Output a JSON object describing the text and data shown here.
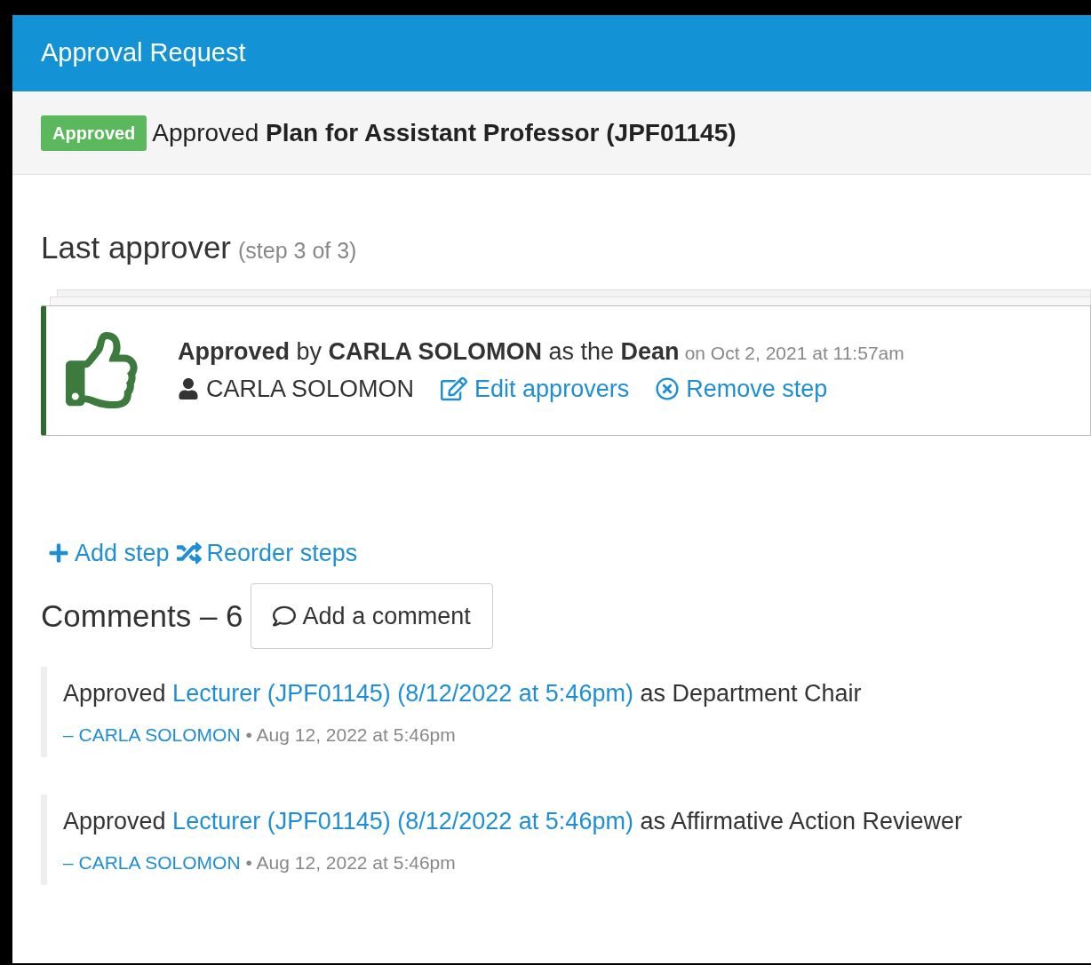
{
  "window": {
    "title": "Approval Request"
  },
  "status": {
    "badge": "Approved",
    "text": "Approved **Plan for Assistant Professor (JPF01145)**"
  },
  "last_approver": {
    "heading": "Last approver",
    "step": "(step 3 of 3)"
  },
  "approval_card": {
    "sentence": "**Approved** by **CARLA SOLOMON** as the **Dean**",
    "date": "on Oct 2, 2021 at 11:57am",
    "approver": "CARLA SOLOMON",
    "edit_link": "Edit approvers",
    "remove_link": "Remove step"
  },
  "step_actions": {
    "add": "Add step",
    "reorder": "Reorder steps"
  },
  "comments": {
    "heading": "Comments – 6",
    "add_button": "Add a comment",
    "items": [
      {
        "prefix": "Approved",
        "link": "Lecturer (JPF01145) (8/12/2022 at 5:46pm)",
        "suffix": "as Department Chair",
        "author": "– CARLA SOLOMON",
        "time": "• Aug 12, 2022 at 5:46pm"
      },
      {
        "prefix": "Approved",
        "link": "Lecturer (JPF01145) (8/12/2022 at 5:46pm)",
        "suffix": "as Affirmative Action Reviewer",
        "author": "– CARLA SOLOMON",
        "time": "• Aug 12, 2022 at 5:46pm"
      }
    ]
  }
}
